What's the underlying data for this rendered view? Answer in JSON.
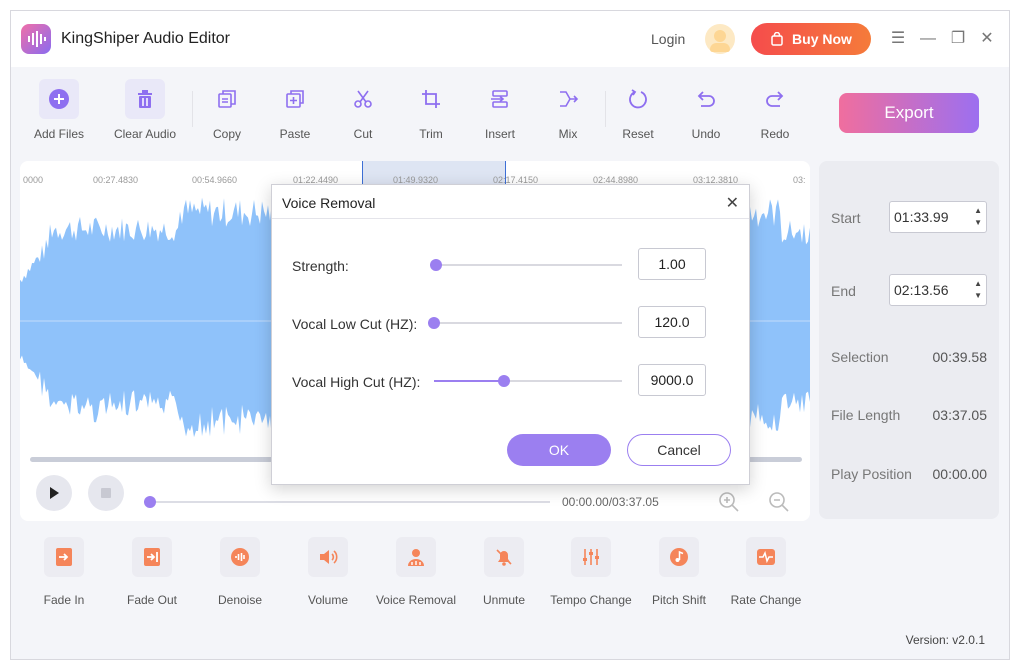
{
  "app": {
    "title": "KingShiper Audio Editor",
    "login": "Login",
    "buy_now": "Buy Now"
  },
  "window_controls": {
    "menu": "☰",
    "minimize": "—",
    "maximize": "❐",
    "close": "✕"
  },
  "toolbar": {
    "add_files": "Add Files",
    "clear_audio": "Clear Audio",
    "copy": "Copy",
    "paste": "Paste",
    "cut": "Cut",
    "trim": "Trim",
    "insert": "Insert",
    "mix": "Mix",
    "reset": "Reset",
    "undo": "Undo",
    "redo": "Redo",
    "export": "Export"
  },
  "ruler": {
    "ticks": [
      "0000",
      "00:27.4830",
      "00:54.9660",
      "01:22.4490",
      "01:49.9320",
      "02:17.4150",
      "02:44.8980",
      "03:12.3810",
      "03:"
    ]
  },
  "player": {
    "time": "00:00.00/03:37.05"
  },
  "side": {
    "start_label": "Start",
    "start_value": "01:33.99",
    "end_label": "End",
    "end_value": "02:13.56",
    "selection_label": "Selection",
    "selection_value": "00:39.58",
    "file_length_label": "File Length",
    "file_length_value": "03:37.05",
    "play_position_label": "Play Position",
    "play_position_value": "00:00.00"
  },
  "effects": {
    "fade_in": "Fade In",
    "fade_out": "Fade Out",
    "denoise": "Denoise",
    "volume": "Volume",
    "voice_removal": "Voice Removal",
    "unmute": "Unmute",
    "tempo_change": "Tempo Change",
    "pitch_shift": "Pitch Shift",
    "rate_change": "Rate Change"
  },
  "footer": {
    "version": "Version: v2.0.1"
  },
  "dialog": {
    "title": "Voice Removal",
    "strength_label": "Strength:",
    "strength_value": "1.00",
    "low_cut_label": "Vocal Low Cut (HZ):",
    "low_cut_value": "120.0",
    "high_cut_label": "Vocal High Cut (HZ):",
    "high_cut_value": "9000.0",
    "ok": "OK",
    "cancel": "Cancel"
  },
  "colors": {
    "accent": "#9b7ff0",
    "waveform": "#8fc2fa",
    "buy_gradient_start": "#f54c4c",
    "export_gradient_start": "#f06e9e"
  }
}
